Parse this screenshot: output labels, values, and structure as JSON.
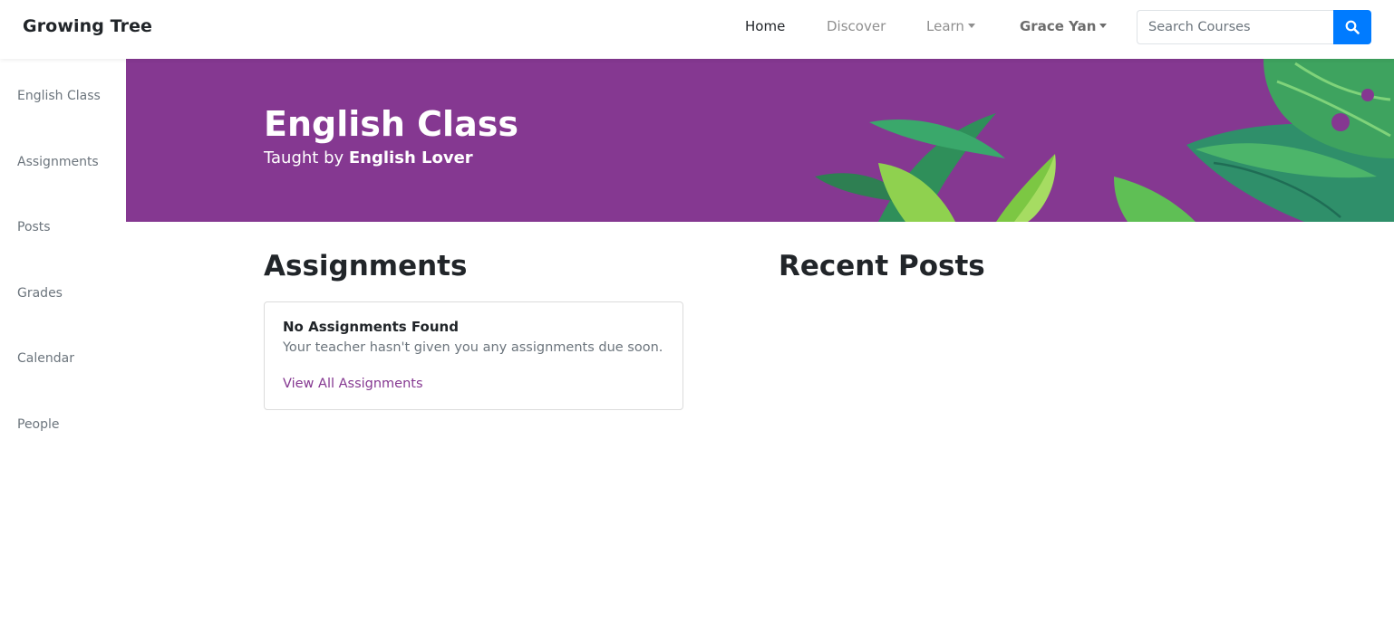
{
  "navbar": {
    "brand": "Growing Tree",
    "links": {
      "home": "Home",
      "discover": "Discover",
      "learn": "Learn",
      "user": "Grace Yan"
    },
    "search": {
      "placeholder": "Search Courses",
      "value": ""
    },
    "icons": {
      "search": "search-icon",
      "dropdown": "caret-down-icon"
    }
  },
  "sidebar": {
    "items": [
      {
        "label": "English Class"
      },
      {
        "label": "Assignments"
      },
      {
        "label": "Posts"
      },
      {
        "label": "Grades"
      },
      {
        "label": "Calendar"
      },
      {
        "label": "People"
      }
    ]
  },
  "banner": {
    "title": "English Class",
    "taught_prefix": "Taught by",
    "teacher": "English Lover",
    "color": "#853891"
  },
  "assignments": {
    "heading": "Assignments",
    "empty_title": "No Assignments Found",
    "empty_text": "Your teacher hasn't given you any assignments due soon.",
    "view_all": "View All Assignments"
  },
  "recent_posts": {
    "heading": "Recent Posts"
  },
  "colors": {
    "accent": "#853891",
    "primary": "#007bff"
  }
}
